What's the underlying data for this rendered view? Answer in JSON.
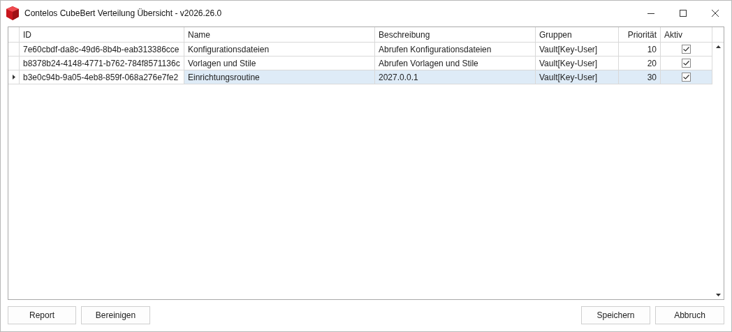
{
  "window": {
    "title": "Contelos CubeBert Verteilung Übersicht - v2026.26.0"
  },
  "table": {
    "columns": [
      "ID",
      "Name",
      "Beschreibung",
      "Gruppen",
      "Priorität",
      "Aktiv"
    ],
    "rows": [
      {
        "id": "7e60cbdf-da8c-49d6-8b4b-eab313386cce",
        "name": "Konfigurationsdateien",
        "beschreibung": "Abrufen Konfigurationsdateien",
        "gruppen": "Vault[Key-User]",
        "prioritaet": "10",
        "aktiv": true,
        "selected": false
      },
      {
        "id": "b8378b24-4148-4771-b762-784f8571136c",
        "name": "Vorlagen und Stile",
        "beschreibung": "Abrufen Vorlagen und Stile",
        "gruppen": "Vault[Key-User]",
        "prioritaet": "20",
        "aktiv": true,
        "selected": false
      },
      {
        "id": "b3e0c94b-9a05-4eb8-859f-068a276e7fe2",
        "name": "Einrichtungsroutine",
        "beschreibung": "2027.0.0.1",
        "gruppen": "Vault[Key-User]",
        "prioritaet": "30",
        "aktiv": true,
        "selected": true
      }
    ]
  },
  "buttons_left": [
    "Report",
    "Bereinigen"
  ],
  "buttons_right": [
    "Speichern",
    "Abbruch"
  ]
}
